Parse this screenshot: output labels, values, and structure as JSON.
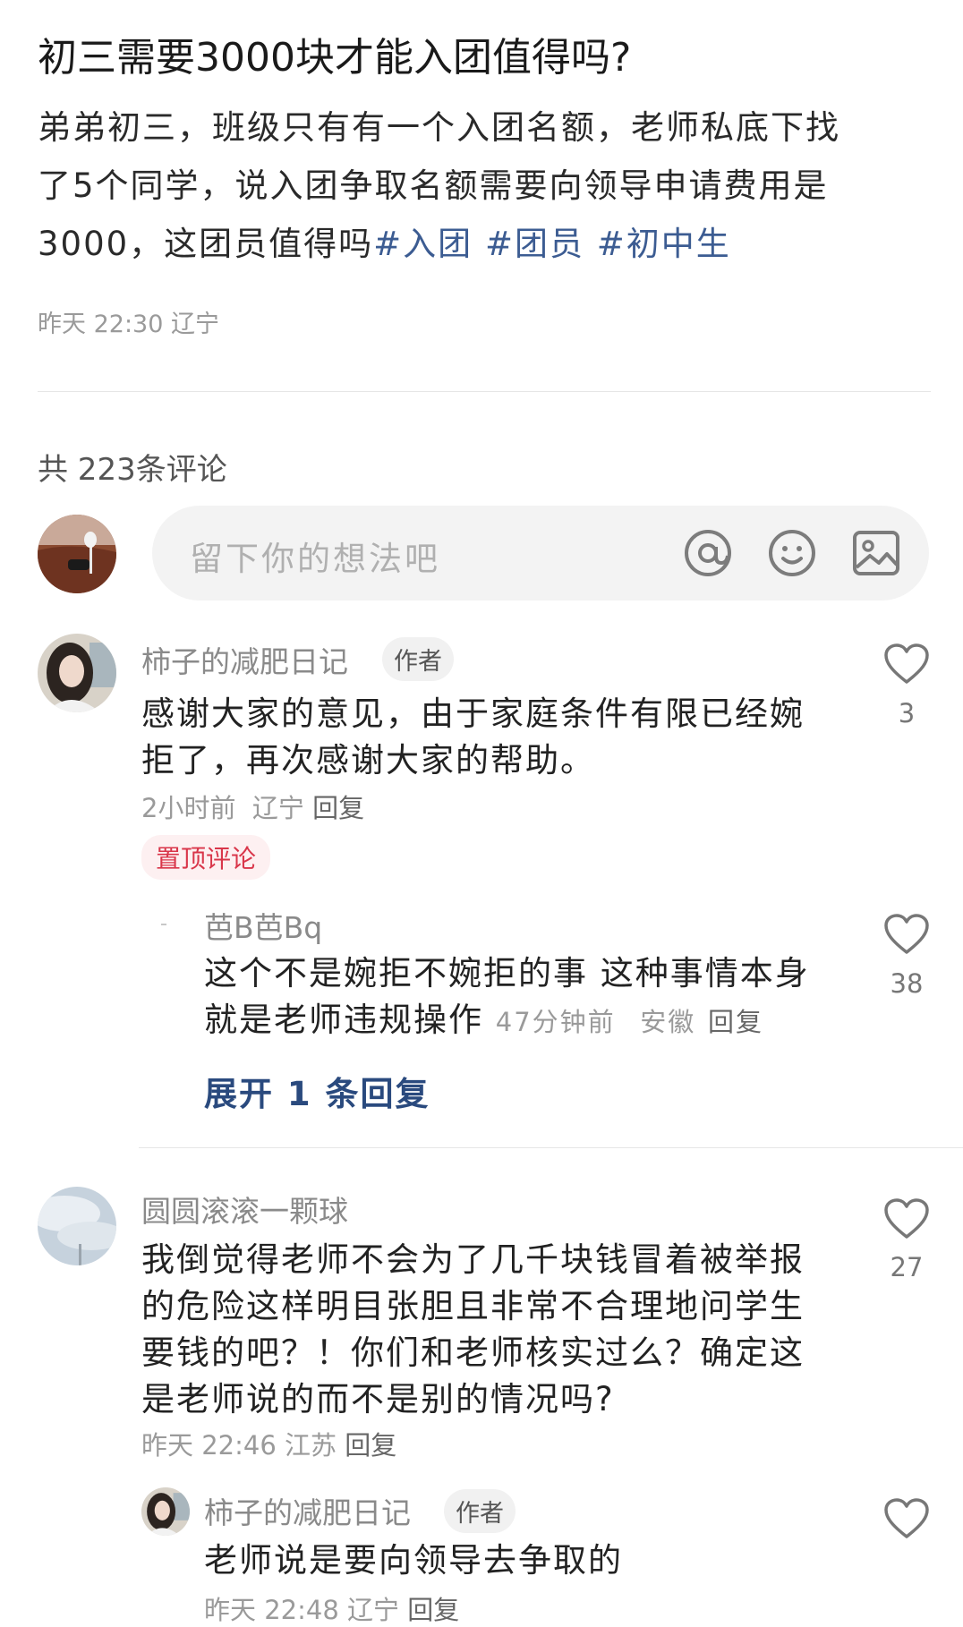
{
  "post": {
    "title": "初三需要3000块才能入团值得吗?",
    "body_line1": "弟弟初三，班级只有有一个入团名额，老师私底下找",
    "body_line2": "了5个同学，说入团争取名额需要向领导申请费用是",
    "body_line3": "3000，这团员值得吗",
    "tags": [
      "#入团",
      "#团员",
      "#初中生"
    ],
    "meta": "昨天 22:30 辽宁"
  },
  "comments_header": {
    "count_text": "共 223条评论"
  },
  "comment_input": {
    "placeholder": "留下你的想法吧",
    "icons": [
      "at-icon",
      "emoji-icon",
      "image-icon"
    ]
  },
  "comments": [
    {
      "username": "柿子的减肥日记",
      "badge": "作者",
      "text_line1": "感谢大家的意见，由于家庭条件有限已经婉",
      "text_line2": "拒了，再次感谢大家的帮助。",
      "time": "2小时前",
      "location": "辽宁",
      "reply_label": "回复",
      "pinned_label": "置顶评论",
      "likes": "3",
      "replies": [
        {
          "username": "芭B芭Bq",
          "text_line1": "这个不是婉拒不婉拒的事 这种事情本身",
          "text_line2": "就是老师违规操作",
          "time": "47分钟前",
          "location": "安徽",
          "reply_label": "回复",
          "likes": "38"
        }
      ],
      "expand_label": "展开 1 条回复"
    },
    {
      "username": "圆圆滚滚一颗球",
      "text_line1": "我倒觉得老师不会为了几千块钱冒着被举报",
      "text_line2": "的危险这样明目张胆且非常不合理地问学生",
      "text_line3": "要钱的吧？！你们和老师核实过么？确定这",
      "text_line4": "是老师说的而不是别的情况吗?",
      "time": "昨天 22:46",
      "location": "江苏",
      "reply_label": "回复",
      "likes": "27",
      "replies": [
        {
          "username": "柿子的减肥日记",
          "badge": "作者",
          "text_line1": "老师说是要向领导去争取的",
          "time": "昨天 22:48",
          "location": "辽宁",
          "reply_label": "回复"
        }
      ]
    }
  ],
  "colors": {
    "tag": "#3c5c92",
    "pinned": "#d9364a",
    "expand": "#2a4a7e"
  }
}
